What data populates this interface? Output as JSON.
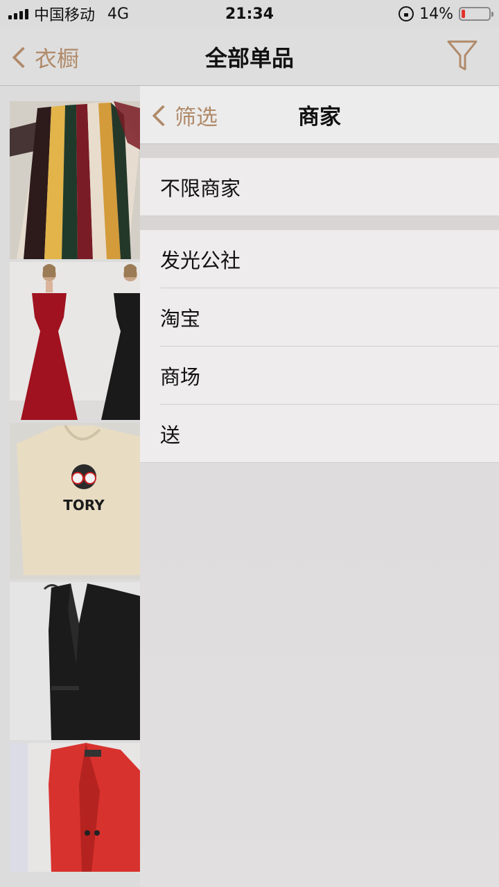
{
  "status_bar": {
    "carrier": "中国移动",
    "network": "4G",
    "time": "21:34",
    "battery_percent": "14%",
    "battery_level": 0.14,
    "battery_color": "#e0322b"
  },
  "nav": {
    "back_label": "衣橱",
    "title": "全部单品",
    "filter_icon": "funnel-icon",
    "accent_color": "#b08a6a"
  },
  "thumbnails": [
    {
      "icon": "striped-dress-photo"
    },
    {
      "icon": "red-and-black-gowns-photo"
    },
    {
      "icon": "tory-hoodie-photo",
      "caption": "TORY"
    },
    {
      "icon": "black-vest-photo"
    },
    {
      "icon": "red-coat-photo"
    }
  ],
  "filter_panel": {
    "back_label": "筛选",
    "title": "商家",
    "all_option": "不限商家",
    "merchants": [
      "发光公社",
      "淘宝",
      "商场",
      "送"
    ]
  }
}
